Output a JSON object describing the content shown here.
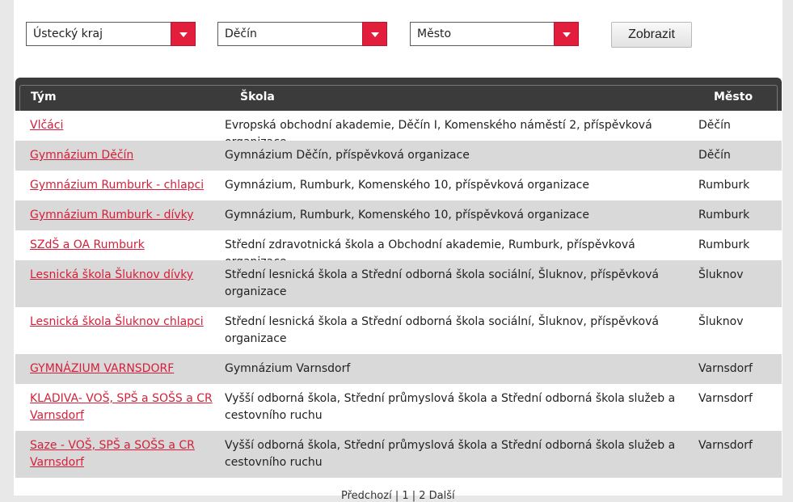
{
  "filters": {
    "region": "Ústecký kraj",
    "district": "Děčín",
    "city": "Město",
    "submit_label": "Zobrazit"
  },
  "table": {
    "headers": {
      "team": "Tým",
      "school": "Škola",
      "city": "Město"
    },
    "rows": [
      {
        "team": "Vlčáci",
        "school": "Evropská obchodní akademie, Děčín I, Komenského náměstí 2, příspěvková organizace",
        "city": "Děčín"
      },
      {
        "team": "Gymnázium Děčín",
        "school": "Gymnázium Děčín, příspěvková organizace",
        "city": "Děčín"
      },
      {
        "team": "Gymnázium Rumburk - chlapci",
        "school": "Gymnázium, Rumburk, Komenského 10, příspěvková organizace",
        "city": "Rumburk"
      },
      {
        "team": "Gymnázium Rumburk - dívky",
        "school": "Gymnázium, Rumburk, Komenského 10, příspěvková organizace",
        "city": "Rumburk"
      },
      {
        "team": "SZdŠ a OA Rumburk",
        "school": "Střední zdravotnická škola a Obchodní akademie, Rumburk, příspěvková organizace",
        "city": "Rumburk"
      },
      {
        "team": "Lesnická škola Šluknov dívky",
        "school": "Střední lesnická škola a Střední odborná škola sociální, Šluknov, příspěvková organizace",
        "city": "Šluknov"
      },
      {
        "team": "Lesnická škola Šluknov chlapci",
        "school": "Střední lesnická škola a Střední odborná škola sociální, Šluknov, příspěvková organizace",
        "city": "Šluknov"
      },
      {
        "team": "GYMNÁZIUM VARNSDORF",
        "school": "Gymnázium Varnsdorf",
        "city": "Varnsdorf"
      },
      {
        "team": "KLADIVA- VOŠ, SPŠ a SOŠS a CR Varnsdorf",
        "school": "Vyšší odborná škola, Střední průmyslová škola a Střední odborná škola služeb a cestovního ruchu",
        "city": "Varnsdorf"
      },
      {
        "team": "Saze - VOŠ, SPŠ a SOŠS a CR Varnsdorf",
        "school": "Vyšší odborná škola, Střední průmyslová škola a Střední odborná škola služeb a cestovního ruchu",
        "city": "Varnsdorf"
      }
    ]
  },
  "pagination_text": "Předchozí | 1 | 2 Další"
}
